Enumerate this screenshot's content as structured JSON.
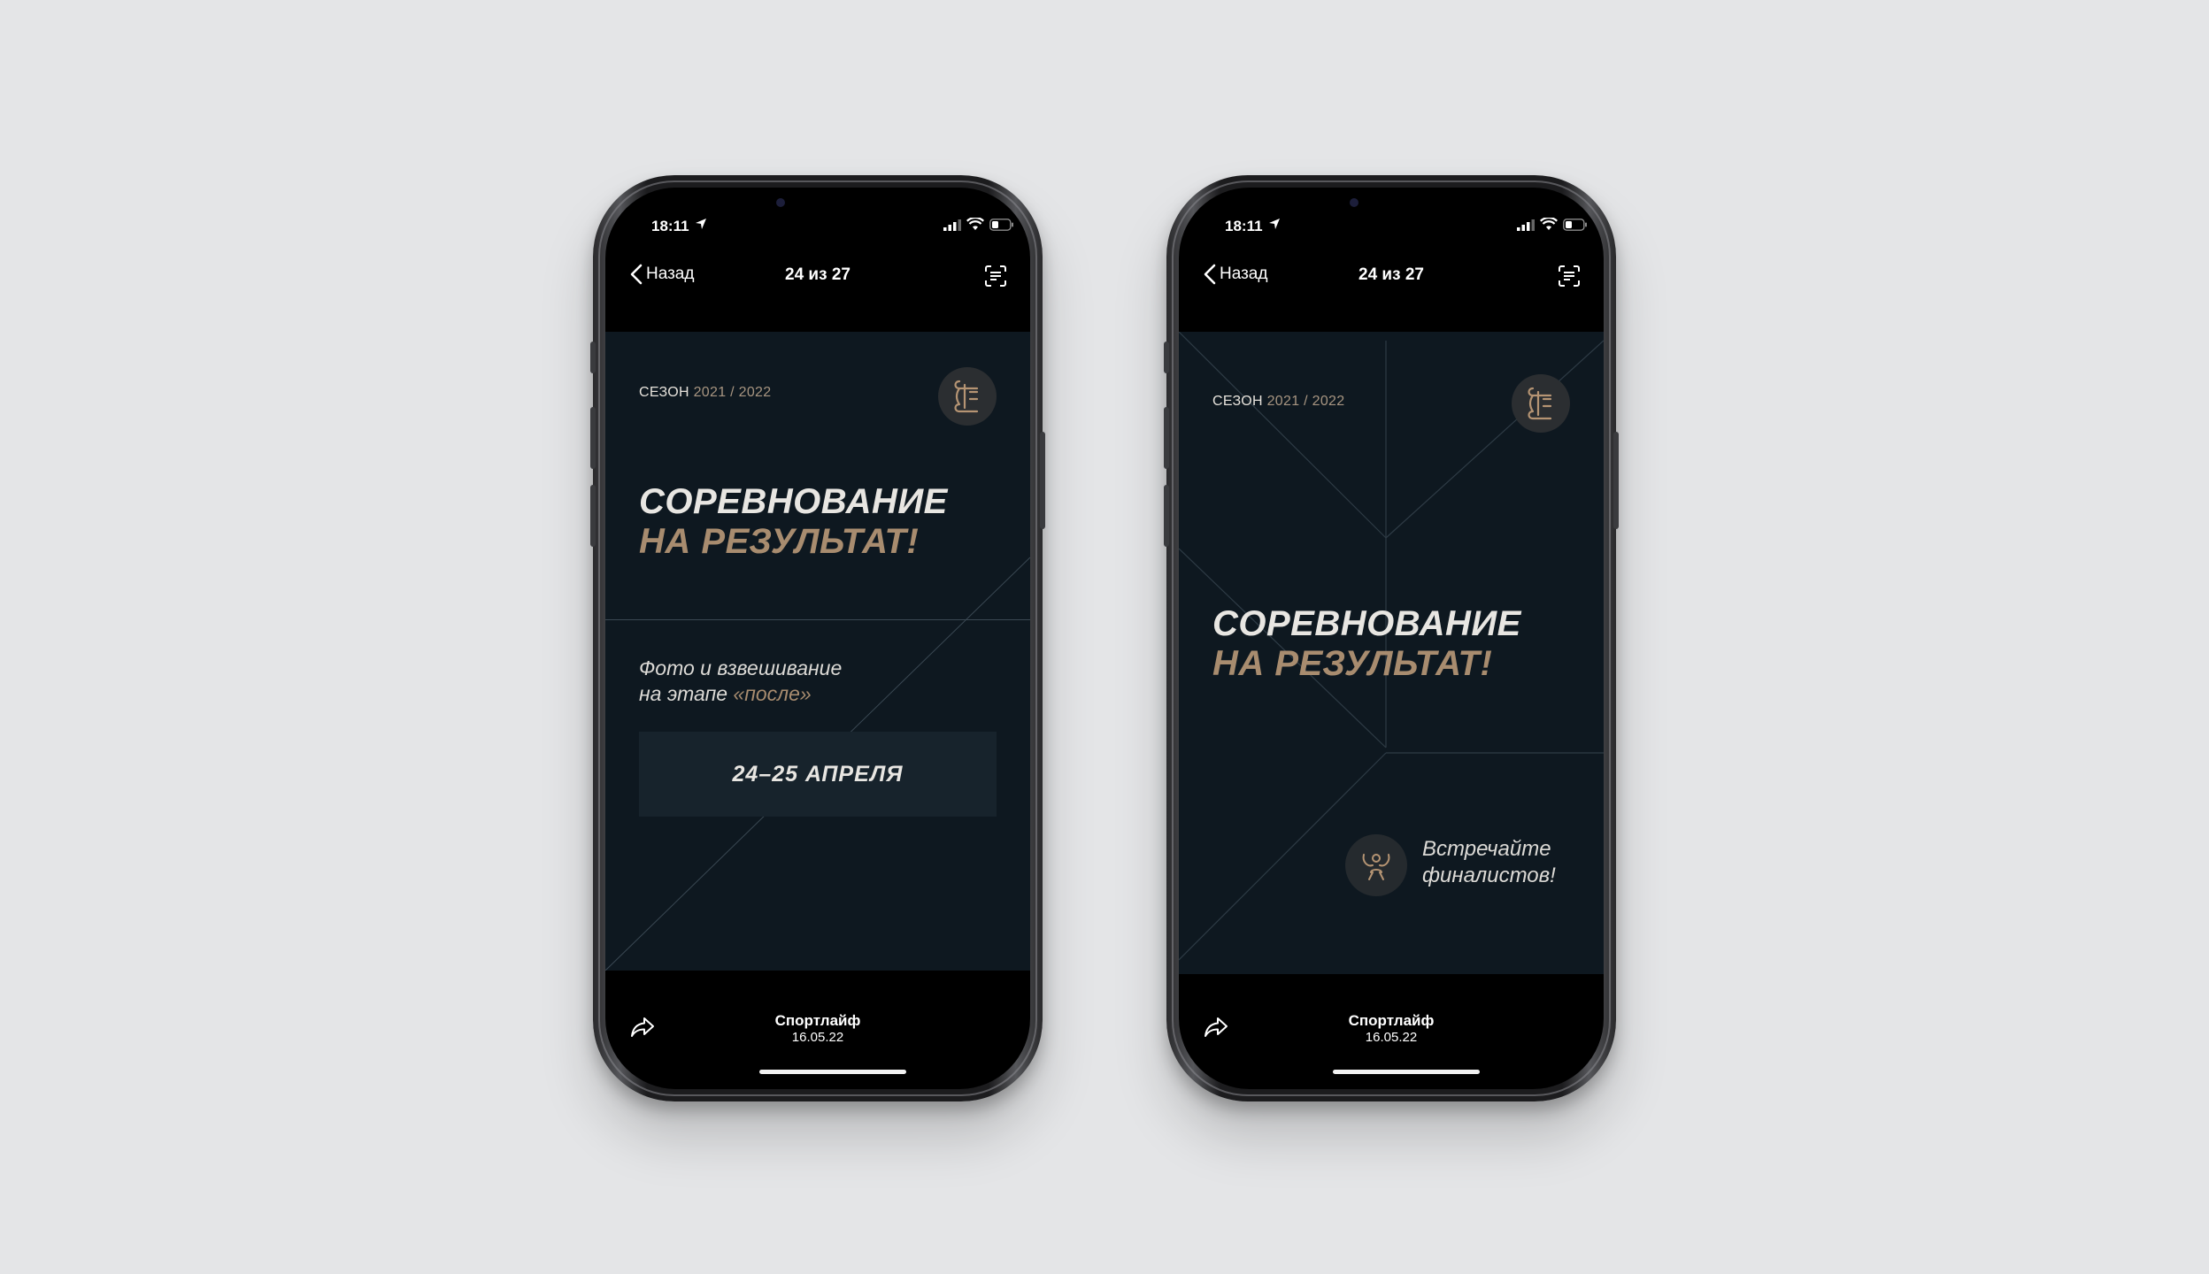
{
  "phones": [
    {
      "status": {
        "time": "18:11"
      },
      "nav": {
        "back_label": "Назад",
        "title": "24 из 27"
      },
      "post": {
        "season_label": "СЕЗОН",
        "season_years": "2021 / 2022",
        "headline_line1": "СОРЕВНОВАНИЕ",
        "headline_line2": "НА РЕЗУЛЬТАТ!",
        "subtitle_line1": "Фото и взвешивание",
        "subtitle_line2_prefix": "на этапе ",
        "subtitle_accent": "«после»",
        "date_label": "24–25 АПРЕЛЯ"
      },
      "toolbar": {
        "author": "Спортлайф",
        "date": "16.05.22"
      }
    },
    {
      "status": {
        "time": "18:11"
      },
      "nav": {
        "back_label": "Назад",
        "title": "24 из 27"
      },
      "post": {
        "season_label": "СЕЗОН",
        "season_years": "2021 / 2022",
        "headline_line1": "СОРЕВНОВАНИЕ",
        "headline_line2": "НА РЕЗУЛЬТАТ!",
        "finalists_line1": "Встречайте",
        "finalists_line2": "финалистов!"
      },
      "toolbar": {
        "author": "Спортлайф",
        "date": "16.05.22"
      }
    }
  ],
  "colors": {
    "page_background": "#e4e5e7",
    "post_background": "#0e1820",
    "accent_gold": "#a88c6f",
    "headline_white": "#e8e6e2",
    "date_box": "#17232c"
  },
  "icons": [
    "location-arrow-icon",
    "cellular-signal-icon",
    "wifi-icon",
    "battery-icon",
    "chevron-left-icon",
    "text-scan-icon",
    "brand-logo-icon",
    "finalists-trophy-icon",
    "share-icon"
  ]
}
